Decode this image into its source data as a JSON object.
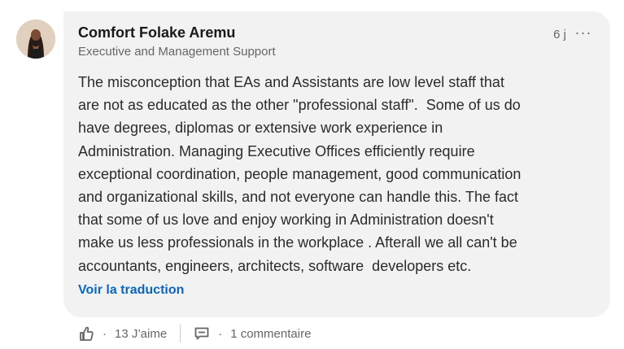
{
  "comment": {
    "author": {
      "name": "Comfort Folake Aremu",
      "headline": "Executive and Management Support"
    },
    "time_ago": "6 j",
    "more_label": "···",
    "text_lines": [
      "The misconception that EAs and Assistants are low level staff that",
      "are not as educated as the other \"professional staff\".  Some of us do",
      "have degrees, diplomas or extensive work experience in",
      "Administration. Managing Executive Offices efficiently require",
      "exceptional coordination, people management, good communication",
      "and organizational skills, and not everyone can handle this. The fact",
      "that some of us love and enjoy working in Administration doesn't",
      "make us less professionals in the workplace . Afterall we all can't be",
      "accountants, engineers, architects, software  developers etc."
    ],
    "translate_label": "Voir la traduction"
  },
  "actions": {
    "like_icon": "thumbs-up-icon",
    "reply_icon": "comment-icon",
    "dot": "·",
    "likes_label": "13 J’aime",
    "replies_label": "1 commentaire"
  },
  "colors": {
    "bubble_bg": "#f2f2f2",
    "link": "#0a66c2",
    "text": "#2b2b2b",
    "muted": "#666666"
  }
}
